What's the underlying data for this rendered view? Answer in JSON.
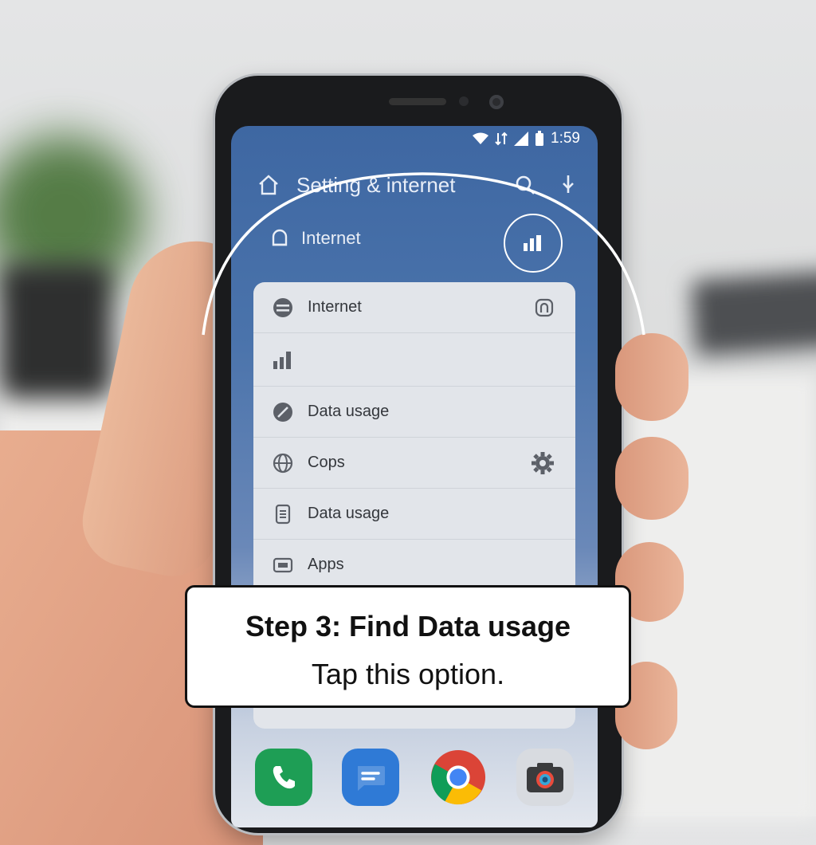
{
  "status_bar": {
    "time": "1:59"
  },
  "app_bar": {
    "title": "Setting & internet"
  },
  "top_row": {
    "label": "Internet"
  },
  "menu": {
    "items": [
      {
        "label": "Internet",
        "icon": "globe-icon",
        "trailing_icon": "lock-icon"
      },
      {
        "label": "",
        "icon": "signal-bars-icon"
      },
      {
        "label": "Data usage",
        "icon": "data-usage-icon"
      },
      {
        "label": "Cops",
        "icon": "globe-icon",
        "trailing_icon": "gear-icon"
      },
      {
        "label": "Data usage",
        "icon": "document-icon"
      },
      {
        "label": "Apps",
        "icon": "apps-icon"
      }
    ]
  },
  "dock": {
    "apps": [
      {
        "name": "phone-app",
        "color": "#1e9e55"
      },
      {
        "name": "messages-app",
        "color": "#2f7ad6"
      },
      {
        "name": "chrome-app",
        "color": "#db4437"
      },
      {
        "name": "camera-app",
        "color": "#3a3b3d"
      }
    ]
  },
  "caption": {
    "heading": "Step 3: Find Data usage",
    "subtext": "Tap this option."
  },
  "colors": {
    "accent": "#3e67a2",
    "sheet": "#e2e5ea"
  }
}
